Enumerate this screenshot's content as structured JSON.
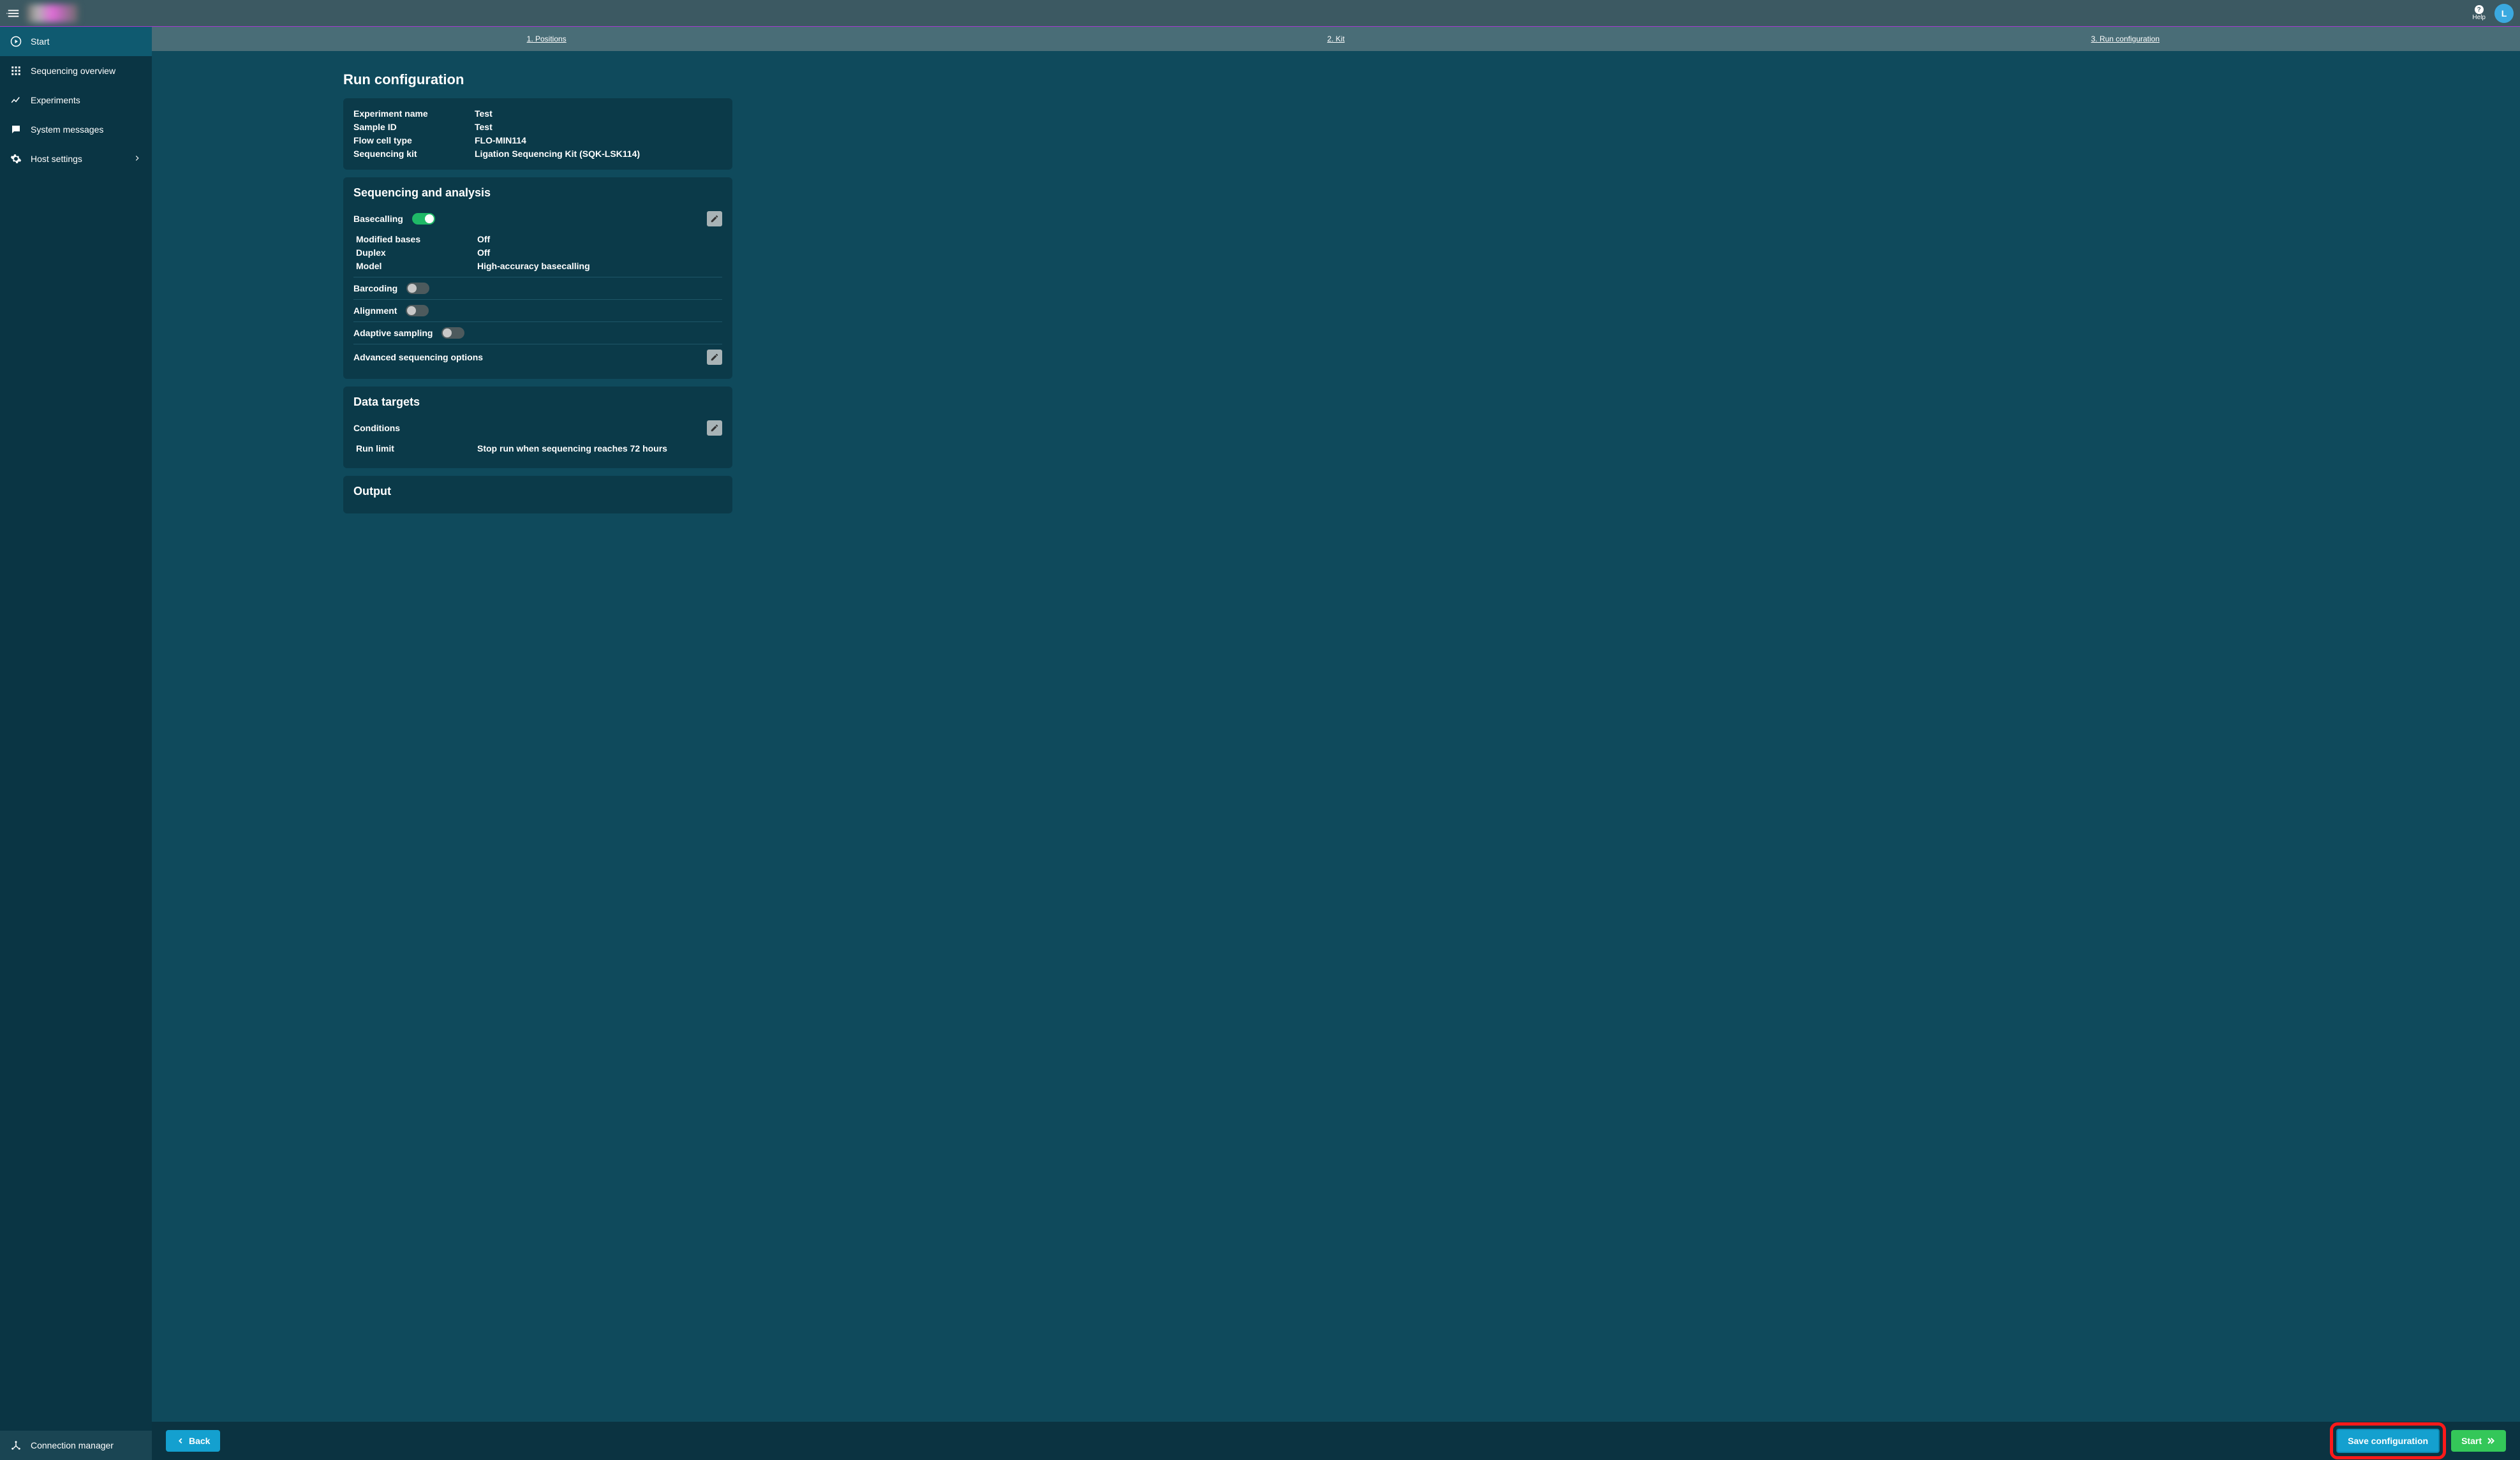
{
  "topbar": {
    "help_label": "Help",
    "avatar_initial": "L"
  },
  "sidebar": {
    "items": [
      {
        "label": "Start",
        "icon": "play-circle"
      },
      {
        "label": "Sequencing overview",
        "icon": "grid"
      },
      {
        "label": "Experiments",
        "icon": "trend"
      },
      {
        "label": "System messages",
        "icon": "chat"
      },
      {
        "label": "Host settings",
        "icon": "gear",
        "chevron": true
      }
    ],
    "bottom": {
      "label": "Connection manager",
      "icon": "hub"
    }
  },
  "stepper": {
    "steps": [
      {
        "label": "1. Positions"
      },
      {
        "label": "2. Kit"
      },
      {
        "label": "3. Run configuration"
      }
    ],
    "active_index": 2
  },
  "page": {
    "title": "Run configuration"
  },
  "summary": {
    "rows": [
      {
        "label": "Experiment name",
        "value": "Test"
      },
      {
        "label": "Sample ID",
        "value": "Test"
      },
      {
        "label": "Flow cell type",
        "value": "FLO-MIN114"
      },
      {
        "label": "Sequencing kit",
        "value": "Ligation Sequencing Kit (SQK-LSK114)"
      }
    ]
  },
  "seq_analysis": {
    "title": "Sequencing and analysis",
    "basecalling": {
      "label": "Basecalling",
      "on": true,
      "rows": [
        {
          "label": "Modified bases",
          "value": "Off"
        },
        {
          "label": "Duplex",
          "value": "Off"
        },
        {
          "label": "Model",
          "value": "High-accuracy basecalling"
        }
      ]
    },
    "barcoding": {
      "label": "Barcoding",
      "on": false
    },
    "alignment": {
      "label": "Alignment",
      "on": false
    },
    "adaptive": {
      "label": "Adaptive sampling",
      "on": false
    },
    "advanced": {
      "label": "Advanced sequencing options"
    }
  },
  "data_targets": {
    "title": "Data targets",
    "conditions_label": "Conditions",
    "rows": [
      {
        "label": "Run limit",
        "value": "Stop run when sequencing reaches 72 hours"
      }
    ]
  },
  "output": {
    "title": "Output"
  },
  "footer": {
    "back": "Back",
    "save": "Save configuration",
    "start": "Start"
  }
}
